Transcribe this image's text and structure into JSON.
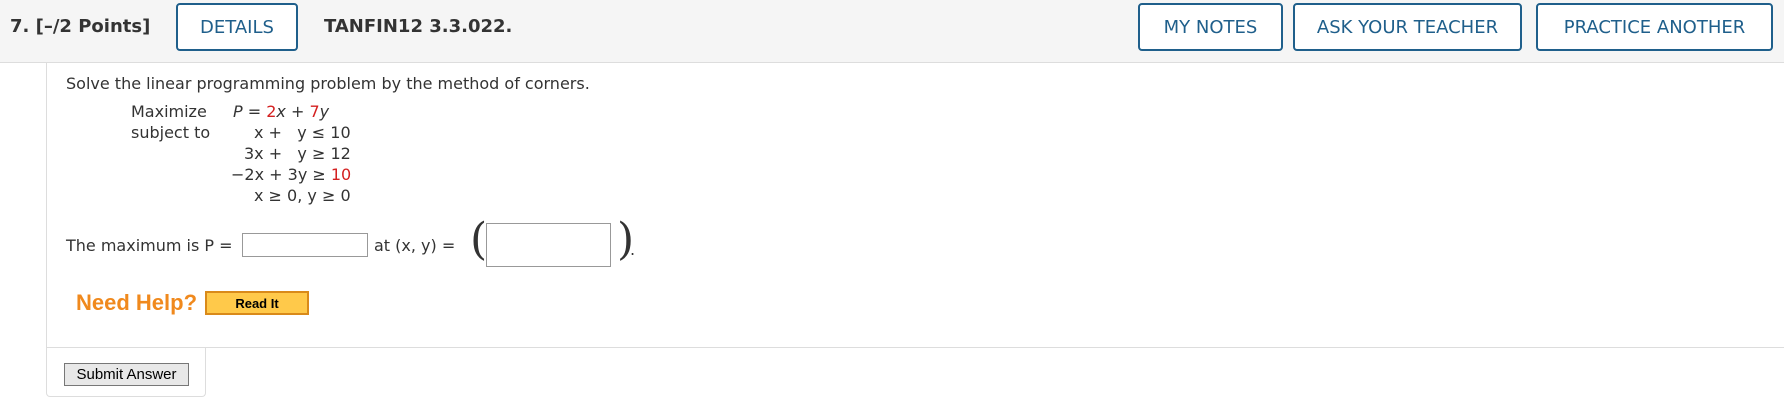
{
  "header": {
    "question_number": "7.  [–/2 Points]",
    "details_label": "DETAILS",
    "question_code": "TANFIN12 3.3.022.",
    "my_notes_label": "MY NOTES",
    "ask_teacher_label": "ASK YOUR TEACHER",
    "practice_label": "PRACTICE ANOTHER"
  },
  "problem": {
    "prompt": "Solve the linear programming problem by the method of corners.",
    "maximize_label": "Maximize",
    "subject_to_label": "subject to",
    "objective": {
      "prefix": "P = ",
      "coef_x": "2",
      "mid": "x + ",
      "coef_y": "7",
      "suffix": "y"
    },
    "constraints": {
      "c1": "x +   y ≤ 10",
      "c2": "3x +   y ≥ 12",
      "c3_left": "−2x + 3y ≥ ",
      "c3_right": "10",
      "c4": "x ≥ 0, y ≥ 0"
    }
  },
  "answer": {
    "max_label": "The maximum is P =",
    "at_label": "at  (x, y) =",
    "p_value": "",
    "xy_value": "",
    "open_paren": "(",
    "close_paren": ")",
    "period": "."
  },
  "help": {
    "need_help_label": "Need Help?",
    "read_it_label": "Read It"
  },
  "submit": {
    "label": "Submit Answer"
  },
  "colors": {
    "accent_blue": "#1f5f8b",
    "red_param": "#d42020",
    "help_orange": "#f0891d"
  }
}
